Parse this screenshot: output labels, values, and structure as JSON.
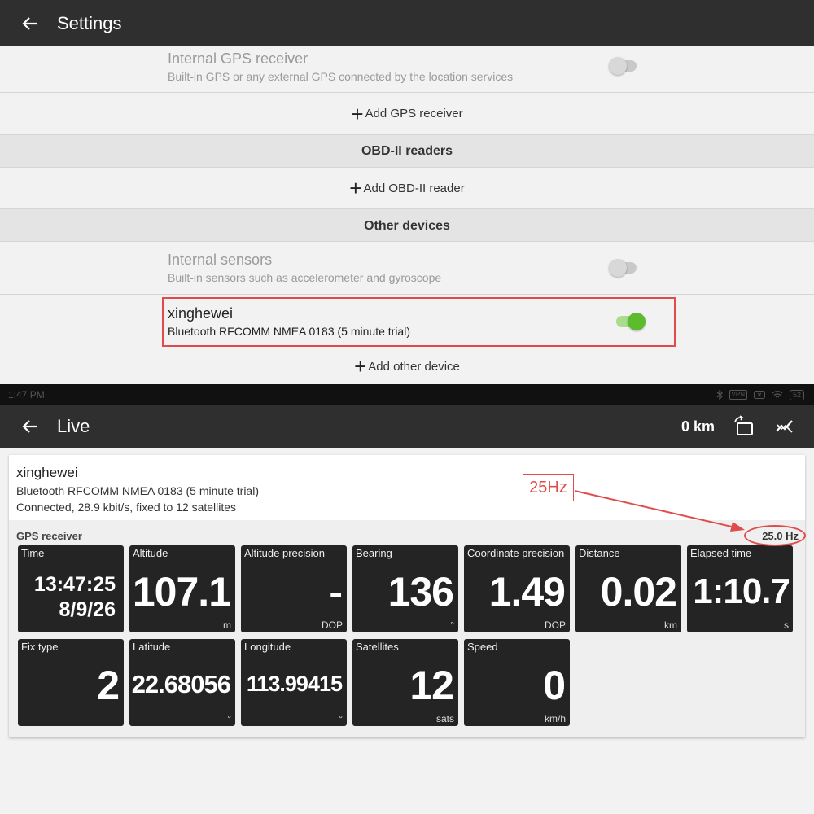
{
  "settings": {
    "title": "Settings",
    "internal_gps": {
      "title": "Internal GPS receiver",
      "subtitle": "Built-in GPS or any external GPS connected by the location services",
      "enabled": false
    },
    "add_gps": "Add GPS receiver",
    "obd_header": "OBD-II readers",
    "add_obd": "Add OBD-II reader",
    "other_header": "Other devices",
    "internal_sensors": {
      "title": "Internal sensors",
      "subtitle": "Built-in sensors such as accelerometer and gyroscope",
      "enabled": false
    },
    "xinghewei": {
      "title": "xinghewei",
      "subtitle": "Bluetooth RFCOMM NMEA 0183 (5 minute trial)",
      "enabled": true
    },
    "add_other": "Add other device"
  },
  "statusbar": {
    "time": "1:47 PM",
    "icons": [
      "bluetooth-icon",
      "vpn-icon",
      "close-icon",
      "wifi-icon",
      "battery-icon"
    ],
    "vpn": "VPN",
    "battery": "52"
  },
  "live": {
    "title": "Live",
    "distance": "0 km",
    "device": {
      "name": "xinghewei",
      "line2": "Bluetooth RFCOMM NMEA 0183 (5 minute trial)",
      "line3": "Connected, 28.9 kbit/s, fixed to 12 satellites"
    },
    "gps_label": "GPS receiver",
    "rate": "25.0 Hz",
    "annotation": "25Hz",
    "tiles_row1": [
      {
        "label": "Time",
        "time": "13:47:25",
        "date": "8/9/26"
      },
      {
        "label": "Altitude",
        "value": "107.1",
        "unit": "m"
      },
      {
        "label": "Altitude precision",
        "value": "-",
        "unit": "DOP"
      },
      {
        "label": "Bearing",
        "value": "136",
        "unit": "°"
      },
      {
        "label": "Coordinate precision",
        "value": "1.49",
        "unit": "DOP"
      },
      {
        "label": "Distance",
        "value": "0.02",
        "unit": "km"
      },
      {
        "label": "Elapsed time",
        "value": "1:10.7",
        "unit": "s"
      }
    ],
    "tiles_row2": [
      {
        "label": "Fix type",
        "value": "2",
        "unit": ""
      },
      {
        "label": "Latitude",
        "value": "22.68056",
        "unit": "°"
      },
      {
        "label": "Longitude",
        "value": "113.99415",
        "unit": "°"
      },
      {
        "label": "Satellites",
        "value": "12",
        "unit": "sats"
      },
      {
        "label": "Speed",
        "value": "0",
        "unit": "km/h"
      }
    ]
  },
  "colors": {
    "appbar": "#2f2f2f",
    "toggle_on": "#5dbb2e",
    "annotation_red": "#e04b4b",
    "tile_bg": "#242424"
  }
}
